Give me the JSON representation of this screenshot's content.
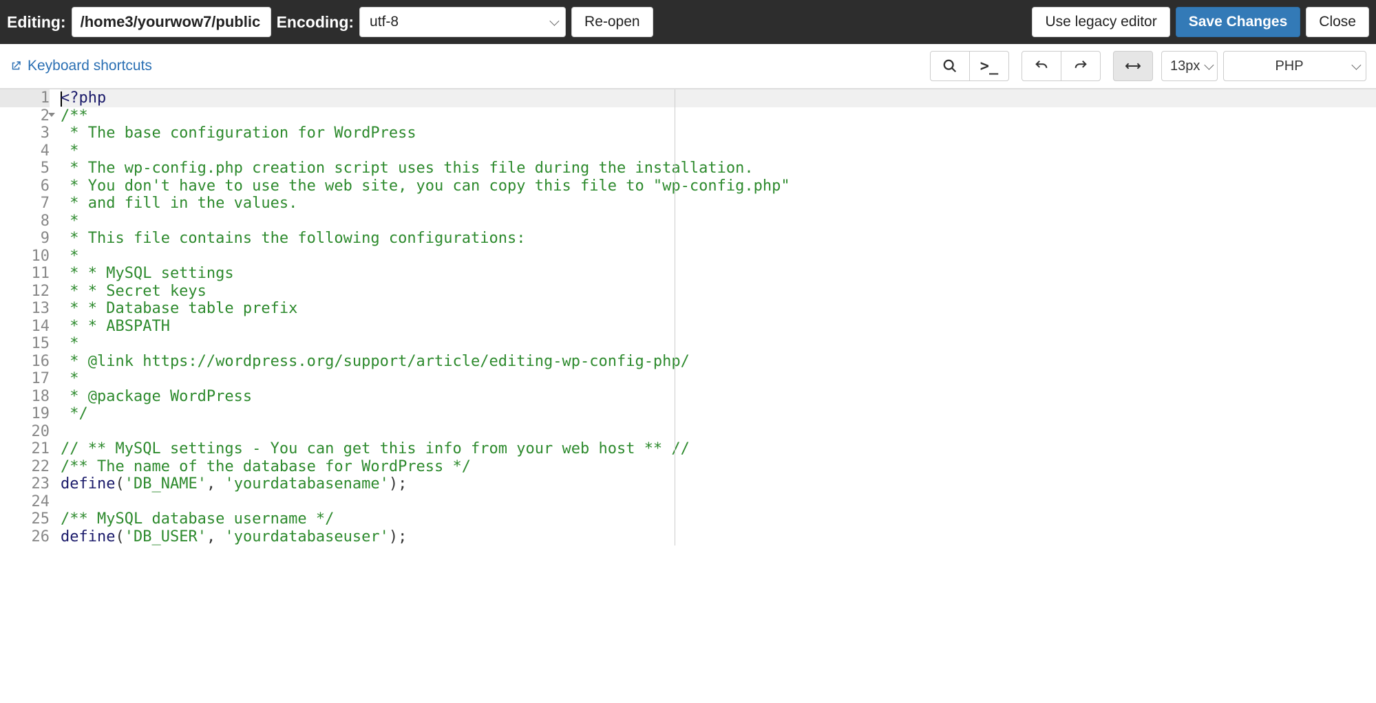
{
  "topbar": {
    "editing_label": "Editing:",
    "filepath": "/home3/yourwow7/public",
    "encoding_label": "Encoding:",
    "encoding_value": "utf-8",
    "reopen": "Re-open",
    "legacy": "Use legacy editor",
    "save": "Save Changes",
    "close": "Close"
  },
  "toolbar": {
    "keyboard_shortcuts": "Keyboard shortcuts",
    "font_size": "13px",
    "language": "PHP",
    "icons": {
      "search": "search-icon",
      "terminal": "terminal-icon",
      "undo": "undo-icon",
      "redo": "redo-icon",
      "wrap": "wrap-icon"
    }
  },
  "code": {
    "lines": [
      {
        "n": 1,
        "type": "tag",
        "text": "<?php"
      },
      {
        "n": 2,
        "type": "comment",
        "text": "/**",
        "fold": true
      },
      {
        "n": 3,
        "type": "comment",
        "text": " * The base configuration for WordPress"
      },
      {
        "n": 4,
        "type": "comment",
        "text": " *"
      },
      {
        "n": 5,
        "type": "comment",
        "text": " * The wp-config.php creation script uses this file during the installation."
      },
      {
        "n": 6,
        "type": "comment",
        "text": " * You don't have to use the web site, you can copy this file to \"wp-config.php\""
      },
      {
        "n": 7,
        "type": "comment",
        "text": " * and fill in the values."
      },
      {
        "n": 8,
        "type": "comment",
        "text": " *"
      },
      {
        "n": 9,
        "type": "comment",
        "text": " * This file contains the following configurations:"
      },
      {
        "n": 10,
        "type": "comment",
        "text": " *"
      },
      {
        "n": 11,
        "type": "comment",
        "text": " * * MySQL settings"
      },
      {
        "n": 12,
        "type": "comment",
        "text": " * * Secret keys"
      },
      {
        "n": 13,
        "type": "comment",
        "text": " * * Database table prefix"
      },
      {
        "n": 14,
        "type": "comment",
        "text": " * * ABSPATH"
      },
      {
        "n": 15,
        "type": "comment",
        "text": " *"
      },
      {
        "n": 16,
        "type": "comment",
        "text": " * @link https://wordpress.org/support/article/editing-wp-config-php/"
      },
      {
        "n": 17,
        "type": "comment",
        "text": " *"
      },
      {
        "n": 18,
        "type": "comment",
        "text": " * @package WordPress"
      },
      {
        "n": 19,
        "type": "comment",
        "text": " */"
      },
      {
        "n": 20,
        "type": "plain",
        "text": ""
      },
      {
        "n": 21,
        "type": "comment",
        "text": "// ** MySQL settings - You can get this info from your web host ** //"
      },
      {
        "n": 22,
        "type": "comment",
        "text": "/** The name of the database for WordPress */"
      },
      {
        "n": 23,
        "type": "define",
        "func": "define",
        "args": [
          "'DB_NAME'",
          "'yourdatabasename'"
        ]
      },
      {
        "n": 24,
        "type": "plain",
        "text": ""
      },
      {
        "n": 25,
        "type": "comment",
        "text": "/** MySQL database username */"
      },
      {
        "n": 26,
        "type": "define",
        "func": "define",
        "args": [
          "'DB_USER'",
          "'yourdatabaseuser'"
        ]
      }
    ]
  }
}
